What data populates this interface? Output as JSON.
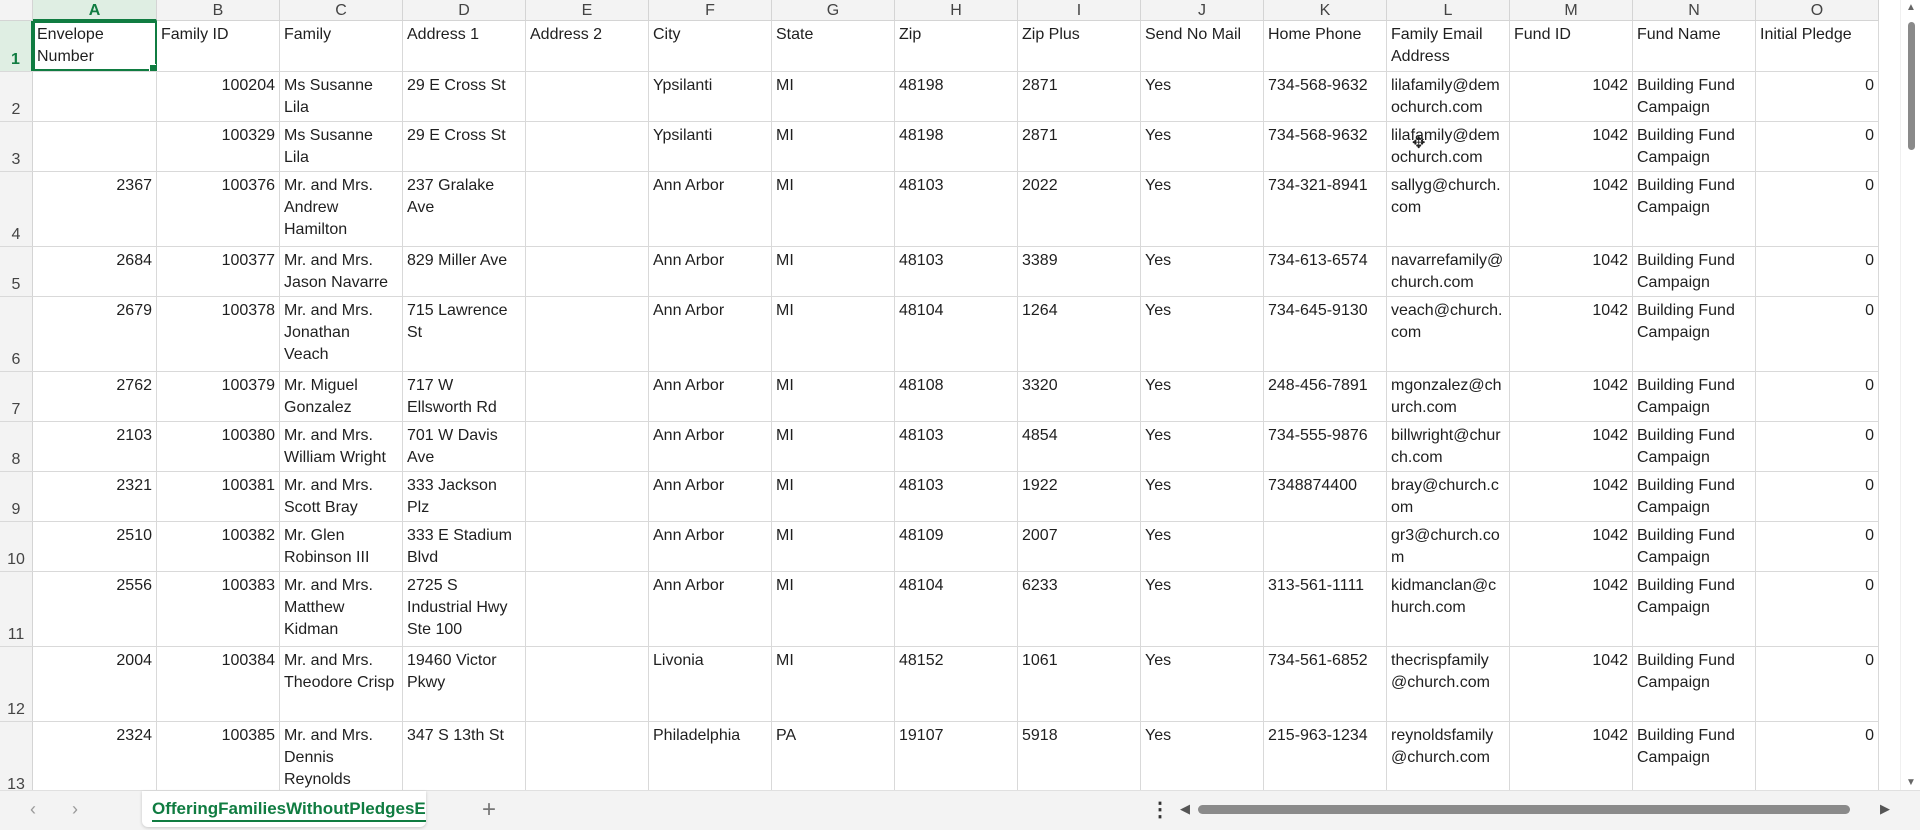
{
  "columns": [
    "A",
    "B",
    "C",
    "D",
    "E",
    "F",
    "G",
    "H",
    "I",
    "J",
    "K",
    "L",
    "M",
    "N",
    "O"
  ],
  "rows": [
    {
      "num": "1",
      "cells": [
        "Envelope Number",
        "Family ID",
        "Family",
        "Address 1",
        "Address 2",
        "City",
        "State",
        "Zip",
        "Zip Plus",
        "Send No Mail",
        "Home Phone",
        "Family Email Address",
        "Fund ID",
        "Fund Name",
        "Initial Pledge"
      ]
    },
    {
      "num": "2",
      "cells": [
        "",
        "100204",
        "Ms Susanne Lila",
        "29 E Cross St",
        "",
        "Ypsilanti",
        "MI",
        "48198",
        "2871",
        "Yes",
        "734-568-9632",
        "lilafamily@demochurch.com",
        "1042",
        "Building Fund Campaign",
        "0"
      ]
    },
    {
      "num": "3",
      "cells": [
        "",
        "100329",
        "Ms Susanne Lila",
        "29 E Cross St",
        "",
        "Ypsilanti",
        "MI",
        "48198",
        "2871",
        "Yes",
        "734-568-9632",
        "lilafamily@demochurch.com",
        "1042",
        "Building Fund Campaign",
        "0"
      ]
    },
    {
      "num": "4",
      "cells": [
        "2367",
        "100376",
        "Mr. and Mrs. Andrew Hamilton",
        "237 Gralake Ave",
        "",
        "Ann Arbor",
        "MI",
        "48103",
        "2022",
        "Yes",
        "734-321-8941",
        "sallyg@church.com",
        "1042",
        "Building Fund Campaign",
        "0"
      ]
    },
    {
      "num": "5",
      "cells": [
        "2684",
        "100377",
        "Mr. and Mrs. Jason Navarre",
        "829 Miller Ave",
        "",
        "Ann Arbor",
        "MI",
        "48103",
        "3389",
        "Yes",
        "734-613-6574",
        "navarrefamily@church.com",
        "1042",
        "Building Fund Campaign",
        "0"
      ]
    },
    {
      "num": "6",
      "cells": [
        "2679",
        "100378",
        "Mr. and Mrs. Jonathan Veach",
        "715 Lawrence St",
        "",
        "Ann Arbor",
        "MI",
        "48104",
        "1264",
        "Yes",
        "734-645-9130",
        "veach@church.com",
        "1042",
        "Building Fund Campaign",
        "0"
      ]
    },
    {
      "num": "7",
      "cells": [
        "2762",
        "100379",
        "Mr. Miguel Gonzalez",
        "717 W Ellsworth Rd",
        "",
        "Ann Arbor",
        "MI",
        "48108",
        "3320",
        "Yes",
        "248-456-7891",
        "mgonzalez@church.com",
        "1042",
        "Building Fund Campaign",
        "0"
      ]
    },
    {
      "num": "8",
      "cells": [
        "2103",
        "100380",
        "Mr. and Mrs. William Wright",
        "701 W Davis Ave",
        "",
        "Ann Arbor",
        "MI",
        "48103",
        "4854",
        "Yes",
        "734-555-9876",
        "billwright@church.com",
        "1042",
        "Building Fund Campaign",
        "0"
      ]
    },
    {
      "num": "9",
      "cells": [
        "2321",
        "100381",
        "Mr. and Mrs. Scott Bray",
        "333 Jackson Plz",
        "",
        "Ann Arbor",
        "MI",
        "48103",
        "1922",
        "Yes",
        "7348874400",
        "bray@church.com",
        "1042",
        "Building Fund Campaign",
        "0"
      ]
    },
    {
      "num": "10",
      "cells": [
        "2510",
        "100382",
        "Mr. Glen Robinson III",
        "333 E Stadium Blvd",
        "",
        "Ann Arbor",
        "MI",
        "48109",
        "2007",
        "Yes",
        "",
        "gr3@church.com",
        "1042",
        "Building Fund Campaign",
        "0"
      ]
    },
    {
      "num": "11",
      "cells": [
        "2556",
        "100383",
        "Mr. and Mrs. Matthew Kidman",
        "2725 S Industrial Hwy Ste 100",
        "",
        "Ann Arbor",
        "MI",
        "48104",
        "6233",
        "Yes",
        "313-561-1111",
        "kidmanclan@church.com",
        "1042",
        "Building Fund Campaign",
        "0"
      ]
    },
    {
      "num": "12",
      "cells": [
        "2004",
        "100384",
        "Mr. and Mrs. Theodore Crisp",
        "19460 Victor Pkwy",
        "",
        "Livonia",
        "MI",
        "48152",
        "1061",
        "Yes",
        "734-561-6852",
        "thecrispfamily@church.com",
        "1042",
        "Building Fund Campaign",
        "0"
      ]
    },
    {
      "num": "13",
      "cells": [
        "2324",
        "100385",
        "Mr. and Mrs. Dennis Reynolds",
        "347 S 13th St",
        "",
        "Philadelphia",
        "PA",
        "19107",
        "5918",
        "Yes",
        "215-963-1234",
        "reynoldsfamily@church.com",
        "1042",
        "Building Fund Campaign",
        "0"
      ]
    }
  ],
  "sheet_tab": "OfferingFamiliesWithoutPledgesE",
  "colors": {
    "accent": "#107c41",
    "header_bg": "#f3f3f3",
    "grid": "#d9d9d9"
  }
}
